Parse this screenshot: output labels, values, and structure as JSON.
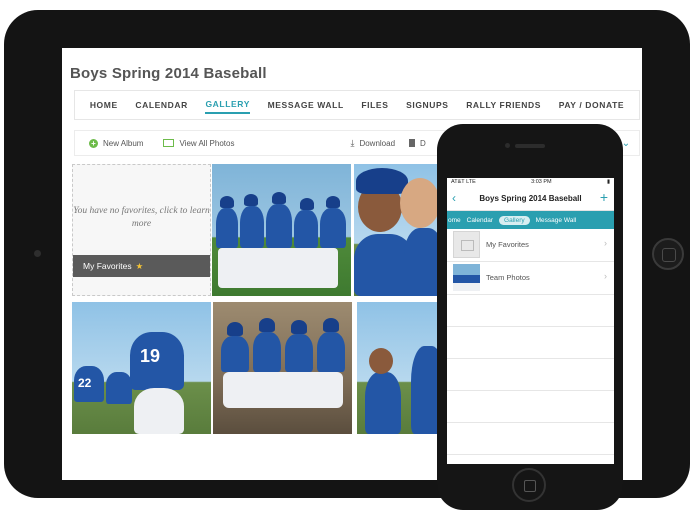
{
  "tablet": {
    "app_title": "Boys Spring 2014 Baseball",
    "nav": [
      "HOME",
      "CALENDAR",
      "GALLERY",
      "MESSAGE WALL",
      "FILES",
      "SIGNUPS",
      "RALLY FRIENDS",
      "PAY / DONATE"
    ],
    "active_nav": "GALLERY",
    "toolbar": {
      "new_album": "New Album",
      "view_all": "View All Photos",
      "download": "Download",
      "delete": "D"
    },
    "favorites": {
      "empty_text": "You have no favorites, click to learn more",
      "label": "My Favorites"
    }
  },
  "phone": {
    "status": {
      "carrier": "AT&T  LTE",
      "time": "3:03 PM"
    },
    "title": "Boys Spring 2014 Baseball",
    "tabs": [
      "ome",
      "Calendar",
      "Gallery",
      "Message Wall"
    ],
    "active_tab": "Gallery",
    "list": [
      {
        "label": "My Favorites",
        "thumb": "empty"
      },
      {
        "label": "Team Photos",
        "thumb": "photo"
      }
    ]
  },
  "colors": {
    "accent": "#2a9fb0",
    "green": "#6dbb4a",
    "jersey": "#2356a6"
  },
  "icons": [
    "plus-icon",
    "photo-icon",
    "download-icon",
    "trash-icon",
    "chevron-down-icon",
    "back-icon",
    "plus-icon",
    "chevron-right-icon",
    "star-icon"
  ]
}
